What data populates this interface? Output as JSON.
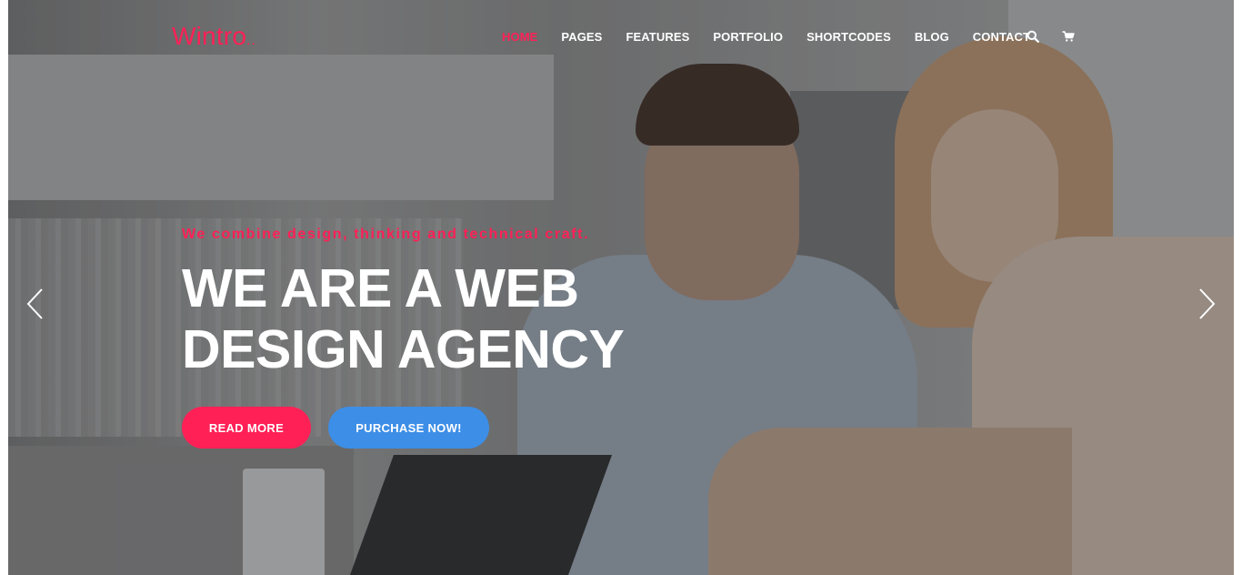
{
  "brand": {
    "name": "Wintro",
    "dots": "..",
    "accent": "#ff2056"
  },
  "nav": {
    "items": [
      {
        "label": "HOME",
        "active": true
      },
      {
        "label": "PAGES",
        "active": false
      },
      {
        "label": "FEATURES",
        "active": false
      },
      {
        "label": "PORTFOLIO",
        "active": false
      },
      {
        "label": "SHORTCODES",
        "active": false
      },
      {
        "label": "BLOG",
        "active": false
      },
      {
        "label": "CONTACT",
        "active": false
      }
    ],
    "icons": [
      "search-icon",
      "cart-icon"
    ]
  },
  "hero": {
    "tagline": "We combine design, thinking and technical craft.",
    "headline_line1": "WE ARE A WEB",
    "headline_line2": "DESIGN AGENCY",
    "buttons": {
      "primary": {
        "label": "READ MORE",
        "color": "#ff2056"
      },
      "secondary": {
        "label": "PURCHASE NOW!",
        "color": "#3d8ee6"
      }
    },
    "arrows": [
      "chevron-left-icon",
      "chevron-right-icon"
    ]
  }
}
